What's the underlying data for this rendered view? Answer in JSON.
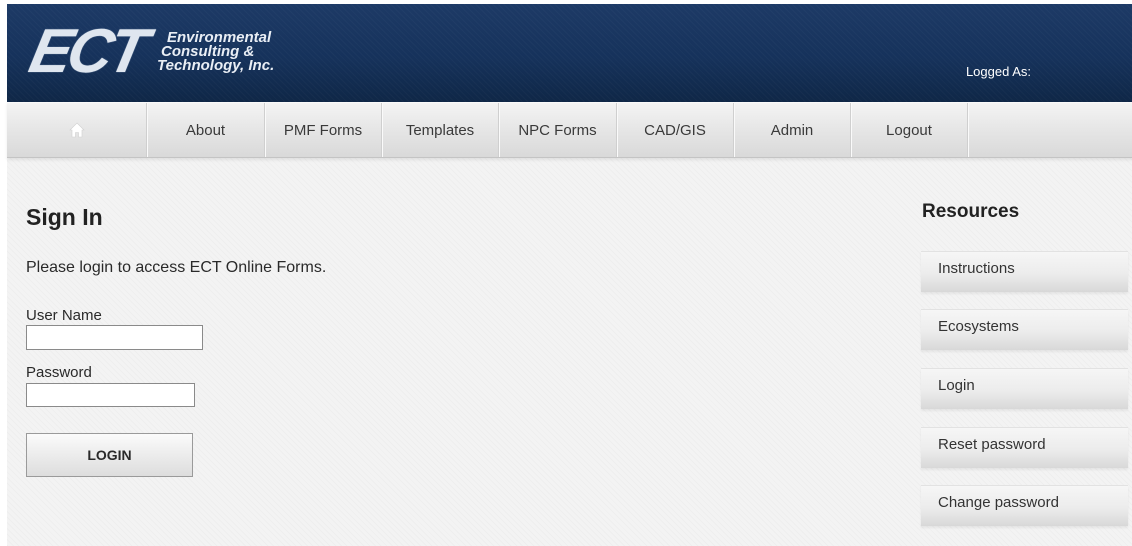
{
  "header": {
    "logo_mark": "ECT",
    "logo_line1": "Environmental",
    "logo_line2": "Consulting &",
    "logo_line3": "Technology, Inc.",
    "logged_as": "Logged As:"
  },
  "nav": {
    "home_icon": "home-icon",
    "items": [
      "About",
      "PMF Forms",
      "Templates",
      "NPC Forms",
      "CAD/GIS",
      "Admin",
      "Logout"
    ]
  },
  "main": {
    "title": "Sign In",
    "intro": "Please login to access ECT Online Forms.",
    "username_label": "User Name",
    "username_value": "",
    "password_label": "Password",
    "password_value": "",
    "login_button": "LOGIN"
  },
  "resources": {
    "title": "Resources",
    "items": [
      "Instructions",
      "Ecosystems",
      "Login",
      "Reset password",
      "Change password"
    ]
  },
  "colors": {
    "header_bg": "#173360",
    "page_bg": "#f3f3f3",
    "nav_bg": "#e7e7e7"
  }
}
